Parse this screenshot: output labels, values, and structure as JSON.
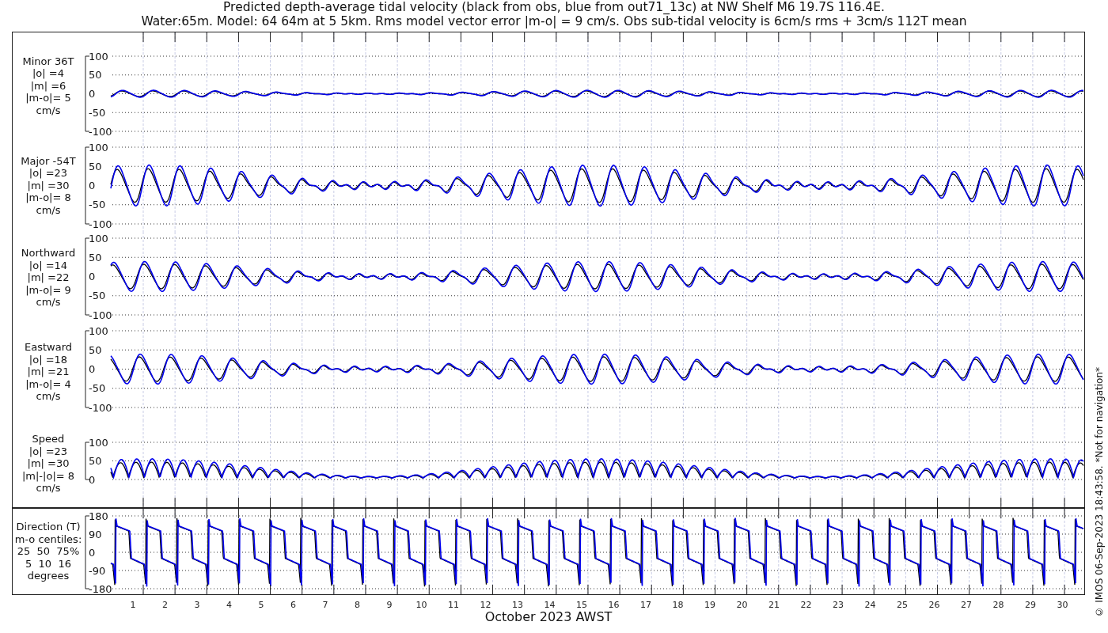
{
  "title": "Predicted depth-average tidal velocity (black from obs, blue from out71_13c) at NW Shelf M6 19.7S 116.4E.",
  "subtitle": "Water:65m. Model: 64 64m at 5 5km. Rms model vector error |m-o| = 9 cm/s. Obs sub-tidal velocity is 6cm/s rms + 3cm/s 112T mean",
  "panels": [
    {
      "kind": "velocity",
      "label": [
        "Minor 36T",
        "|o| =4",
        "|m| =6",
        "|m-o|= 5",
        "cm/s"
      ],
      "yticks": [
        "100",
        "50",
        "0",
        "-50",
        "-100"
      ]
    },
    {
      "kind": "velocity",
      "label": [
        "Major -54T",
        "|o| =23",
        "|m| =30",
        "|m-o|= 8",
        "cm/s"
      ],
      "yticks": [
        "100",
        "50",
        "0",
        "-50",
        "-100"
      ]
    },
    {
      "kind": "velocity",
      "label": [
        "Northward",
        "|o| =14",
        "|m| =22",
        "|m-o|= 9",
        "cm/s"
      ],
      "yticks": [
        "100",
        "50",
        "0",
        "-50",
        "-100"
      ]
    },
    {
      "kind": "velocity",
      "label": [
        "Eastward",
        "|o| =18",
        "|m| =21",
        "|m-o|= 4",
        "cm/s"
      ],
      "yticks": [
        "100",
        "50",
        "0",
        "-50",
        "-100"
      ]
    },
    {
      "kind": "speed",
      "label": [
        "Speed",
        "|o| =23",
        "|m| =30",
        "|m|-|o|= 8",
        "cm/s"
      ],
      "yticks": [
        "100",
        "50",
        "0"
      ]
    },
    {
      "kind": "direction",
      "label": [
        "Direction (T)",
        "m-o centiles:",
        "25  50  75%",
        "5  10  16",
        "degrees"
      ],
      "yticks": [
        "180",
        "90",
        "0",
        "-90",
        "-180"
      ]
    }
  ],
  "days": [
    "1",
    "2",
    "3",
    "4",
    "5",
    "6",
    "7",
    "8",
    "9",
    "10",
    "11",
    "12",
    "13",
    "14",
    "15",
    "16",
    "17",
    "18",
    "19",
    "20",
    "21",
    "22",
    "23",
    "24",
    "25",
    "26",
    "27",
    "28",
    "29",
    "30"
  ],
  "xlabel": "October 2023 AWST",
  "credit": "© IMOS 06-Sep-2023 18:43:58. *Not for navigation*"
}
